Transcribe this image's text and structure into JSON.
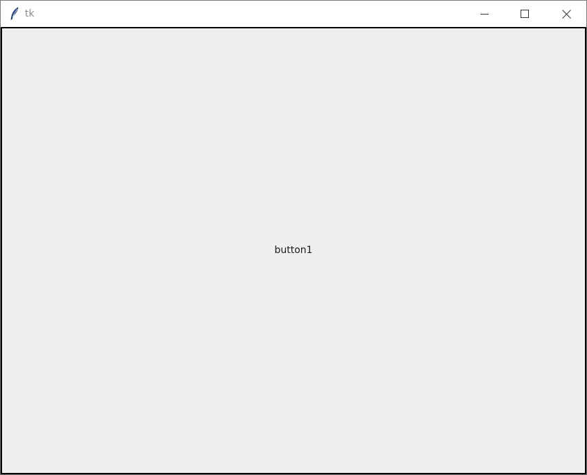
{
  "window": {
    "title": "tk",
    "icon": "tk-feather-icon",
    "controls": {
      "minimize_icon": "minimize-icon",
      "maximize_icon": "maximize-icon",
      "close_icon": "close-icon"
    }
  },
  "content": {
    "button1_label": "button1"
  },
  "colors": {
    "titlebar_bg": "#ffffff",
    "title_text": "#8a8a8a",
    "client_bg": "#efefef",
    "client_border": "#000000"
  }
}
